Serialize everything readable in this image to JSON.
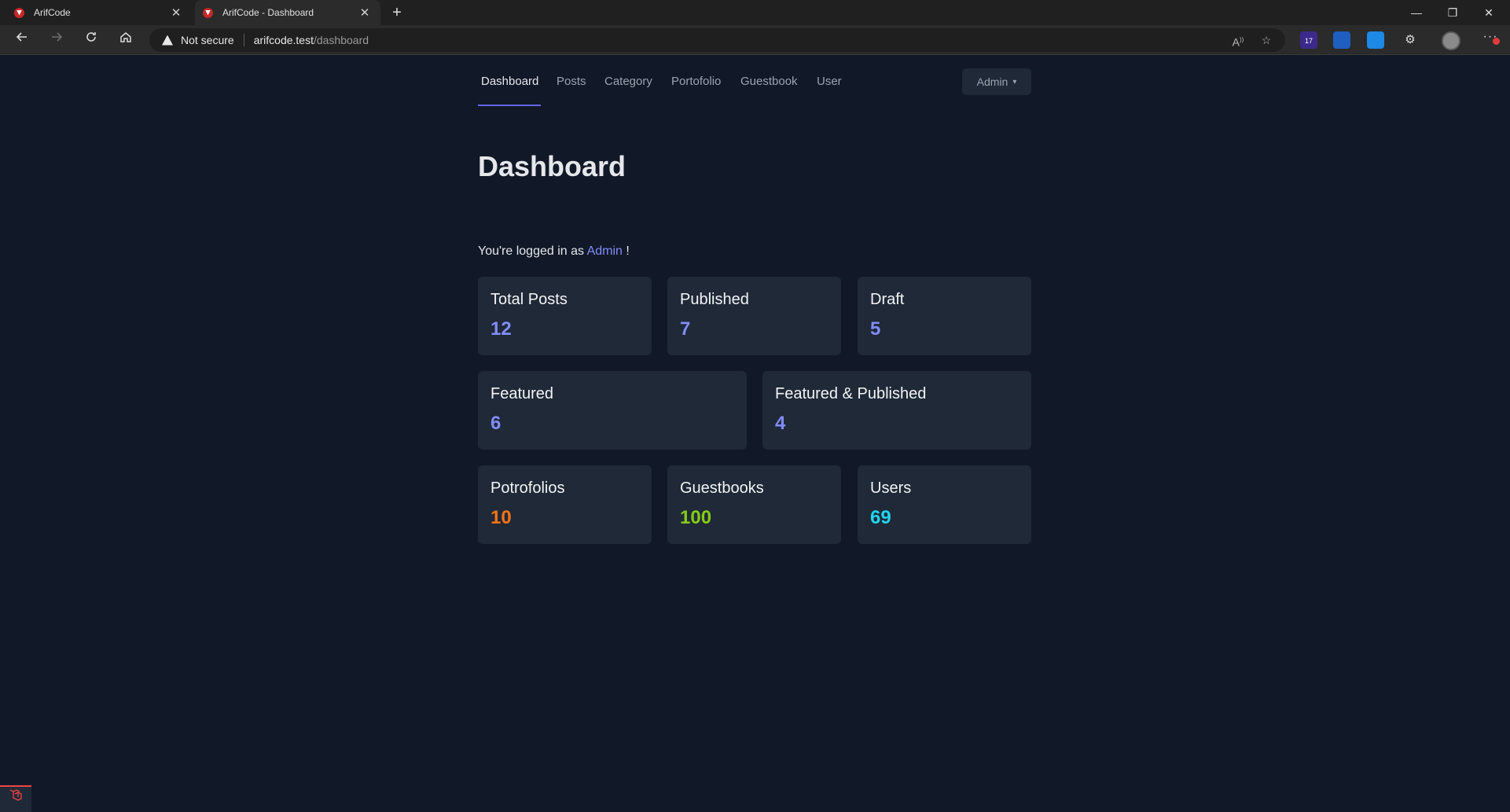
{
  "browser": {
    "tabs": [
      {
        "title": "ArifCode",
        "close": "✕"
      },
      {
        "title": "ArifCode - Dashboard",
        "close": "✕"
      }
    ],
    "new_tab": "+",
    "window_controls": {
      "minimize": "—",
      "restore": "❐",
      "close": "✕"
    },
    "security_label": "Not secure",
    "url_host": "arifcode.test",
    "url_path": "/dashboard",
    "extension_badge": "17",
    "more": "···"
  },
  "nav": {
    "items": [
      "Dashboard",
      "Posts",
      "Category",
      "Portofolio",
      "Guestbook",
      "User"
    ],
    "active": "Dashboard",
    "user_menu": "Admin"
  },
  "page": {
    "title": "Dashboard",
    "logged_prefix": "You're logged in as",
    "logged_user": "Admin",
    "logged_suffix": "!"
  },
  "stats": [
    {
      "label": "Total Posts",
      "value": "12",
      "color": "#818cf8"
    },
    {
      "label": "Published",
      "value": "7",
      "color": "#818cf8"
    },
    {
      "label": "Draft",
      "value": "5",
      "color": "#818cf8"
    },
    {
      "label": "Featured",
      "value": "6",
      "color": "#818cf8"
    },
    {
      "label": "Featured & Published",
      "value": "4",
      "color": "#818cf8"
    },
    {
      "label": "Potrofolios",
      "value": "10",
      "color": "#f97316"
    },
    {
      "label": "Guestbooks",
      "value": "100",
      "color": "#84cc16"
    },
    {
      "label": "Users",
      "value": "69",
      "color": "#22d3ee"
    }
  ],
  "icons": {
    "back": "back-arrow-icon",
    "forward": "forward-arrow-icon",
    "reload": "reload-icon",
    "home": "home-icon",
    "warning": "warning-icon",
    "read_aloud": "read-aloud-icon",
    "favorite": "favorite-icon",
    "chevron": "chevron-down-icon",
    "debugbar": "laravel-icon"
  }
}
